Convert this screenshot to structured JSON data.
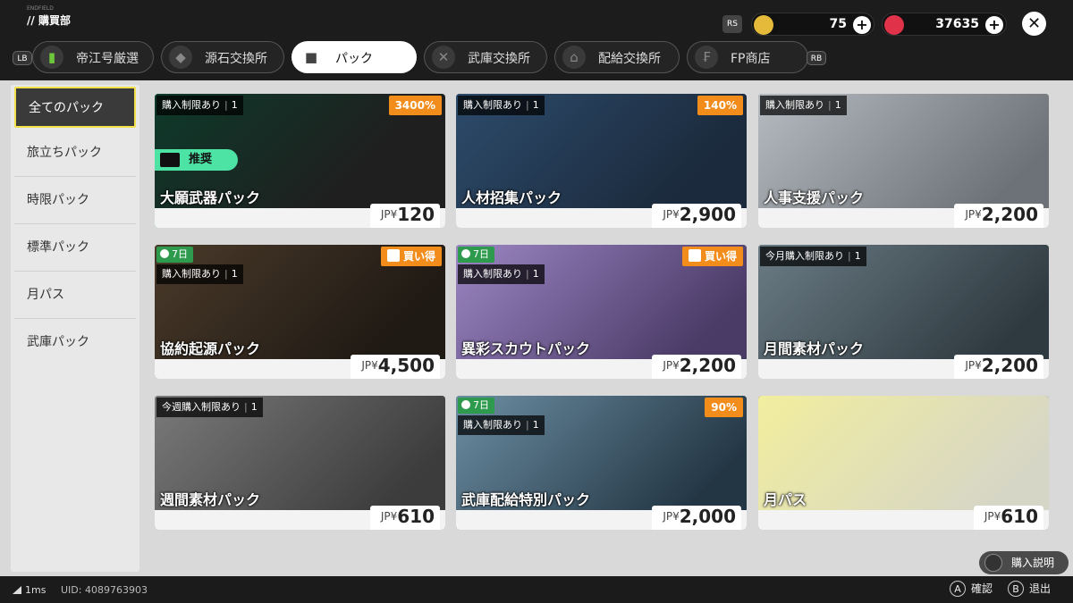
{
  "header": {
    "brand_small": "ENDFIELD",
    "title": "// 購買部",
    "rs_label": "RS",
    "currencies": [
      {
        "name": "originium",
        "value": "75",
        "color": "#e5b93a"
      },
      {
        "name": "orundum",
        "value": "37635",
        "color": "#e0334a"
      }
    ],
    "plus_glyph": "+",
    "close_glyph": "✕"
  },
  "tabs": {
    "lb": "LB",
    "rb": "RB",
    "items": [
      {
        "label": "帝江号厳選",
        "icon": "thumb-up-icon"
      },
      {
        "label": "源石交換所",
        "icon": "crystal-icon"
      },
      {
        "label": "パック",
        "icon": "cube-icon"
      },
      {
        "label": "武庫交換所",
        "icon": "crossed-swords-icon"
      },
      {
        "label": "配給交換所",
        "icon": "basket-icon"
      },
      {
        "label": "FP商店",
        "icon": "fp-icon"
      }
    ],
    "active": 2
  },
  "sidebar": {
    "items": [
      {
        "label": "全てのパック"
      },
      {
        "label": "旅立ちパック"
      },
      {
        "label": "時限パック"
      },
      {
        "label": "標準パック"
      },
      {
        "label": "月パス"
      },
      {
        "label": "武庫パック"
      }
    ],
    "active": 0
  },
  "cards": [
    {
      "name": "大願武器パック",
      "limit": "購入制限あり",
      "limit_count": "1",
      "badge": "3400%",
      "recommend": "推奨",
      "price": "120",
      "currency": "JP¥",
      "colors": [
        "#0e3a2a",
        "#1f1f1f"
      ]
    },
    {
      "name": "人材招集パック",
      "limit": "購入制限あり",
      "limit_count": "1",
      "badge": "140%",
      "price": "2,900",
      "currency": "JP¥",
      "colors": [
        "#2d4b6b",
        "#1b2a3c"
      ]
    },
    {
      "name": "人事支援パック",
      "limit": "購入制限あり",
      "limit_count": "1",
      "price": "2,200",
      "currency": "JP¥",
      "colors": [
        "#9aa0a6",
        "#6c7278"
      ]
    },
    {
      "name": "協約起源パック",
      "days": "7日",
      "limit": "購入制限あり",
      "limit_count": "1",
      "badge": "買い得",
      "price": "4,500",
      "currency": "JP¥",
      "colors": [
        "#4a3a2a",
        "#201a14"
      ]
    },
    {
      "name": "異彩スカウトパック",
      "days": "7日",
      "limit": "購入制限あり",
      "limit_count": "1",
      "badge": "買い得",
      "price": "2,200",
      "currency": "JP¥",
      "colors": [
        "#8f72b8",
        "#4a3a66"
      ]
    },
    {
      "name": "月間素材パック",
      "limit": "今月購入制限あり",
      "limit_count": "1",
      "price": "2,200",
      "currency": "JP¥",
      "colors": [
        "#5b6b73",
        "#2f3a40"
      ]
    },
    {
      "name": "週間素材パック",
      "limit": "今週購入制限あり",
      "limit_count": "1",
      "price": "610",
      "currency": "JP¥",
      "colors": [
        "#707070",
        "#3c3c3c"
      ]
    },
    {
      "name": "武庫配給特別パック",
      "days": "7日",
      "limit": "購入制限あり",
      "limit_count": "1",
      "badge": "90%",
      "price": "2,000",
      "currency": "JP¥",
      "colors": [
        "#4c6f86",
        "#233644"
      ]
    },
    {
      "name": "月パス",
      "price": "610",
      "currency": "JP¥",
      "colors": [
        "#f0ec9a",
        "#d8d8c8"
      ]
    }
  ],
  "footer": {
    "ping": "1ms",
    "uid": "UID: 4089763903",
    "help": "購入説明",
    "confirm_key": "A",
    "confirm": "確認",
    "exit_key": "B",
    "exit": "退出"
  }
}
